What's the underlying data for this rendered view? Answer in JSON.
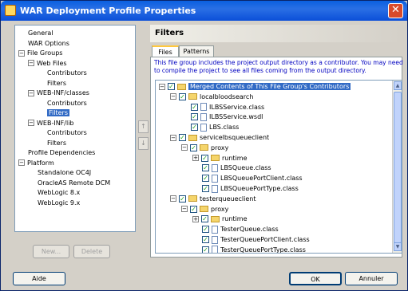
{
  "window": {
    "title": "WAR Deployment Profile Properties",
    "close_label": "✕"
  },
  "nav": {
    "items": [
      {
        "label": "General",
        "toggle": ""
      },
      {
        "label": "WAR Options",
        "toggle": ""
      },
      {
        "label": "File Groups",
        "toggle": "−"
      },
      {
        "label": "Web Files",
        "toggle": "−"
      },
      {
        "label": "Contributors",
        "toggle": ""
      },
      {
        "label": "Filters",
        "toggle": ""
      },
      {
        "label": "WEB-INF/classes",
        "toggle": "−"
      },
      {
        "label": "Contributors",
        "toggle": ""
      },
      {
        "label": "Filters",
        "toggle": ""
      },
      {
        "label": "WEB-INF/lib",
        "toggle": "−"
      },
      {
        "label": "Contributors",
        "toggle": ""
      },
      {
        "label": "Filters",
        "toggle": ""
      },
      {
        "label": "Profile Dependencies",
        "toggle": ""
      },
      {
        "label": "Platform",
        "toggle": "−"
      },
      {
        "label": "Standalone OC4J",
        "toggle": ""
      },
      {
        "label": "OracleAS Remote DCM",
        "toggle": ""
      },
      {
        "label": "WebLogic 8.x",
        "toggle": ""
      },
      {
        "label": "WebLogic 9.x",
        "toggle": ""
      }
    ],
    "selected": "Filters",
    "new_button": "New...",
    "delete_button": "Delete",
    "move_up": "↑",
    "move_down": "↓"
  },
  "main": {
    "title": "Filters",
    "tabs": [
      {
        "label": "Files"
      },
      {
        "label": "Patterns"
      }
    ],
    "active_tab": "Files",
    "description": "This file group includes the project output directory as a contributor.  You may need to compile the project to see all files coming from the output directory.",
    "tree": [
      {
        "label": "Merged Contents of This File Group's Contributors",
        "type": "folder",
        "toggle": "−"
      },
      {
        "label": "localbloodsearch",
        "type": "folder",
        "toggle": "−"
      },
      {
        "label": "ILBSService.class",
        "type": "file",
        "toggle": ""
      },
      {
        "label": "ILBSService.wsdl",
        "type": "file",
        "toggle": ""
      },
      {
        "label": "LBS.class",
        "type": "file",
        "toggle": ""
      },
      {
        "label": "servicelbsqueueclient",
        "type": "folder",
        "toggle": "−"
      },
      {
        "label": "proxy",
        "type": "folder",
        "toggle": "−"
      },
      {
        "label": "runtime",
        "type": "folder",
        "toggle": "+"
      },
      {
        "label": "LBSQueue.class",
        "type": "file",
        "toggle": ""
      },
      {
        "label": "LBSQueuePortClient.class",
        "type": "file",
        "toggle": ""
      },
      {
        "label": "LBSQueuePortType.class",
        "type": "file",
        "toggle": ""
      },
      {
        "label": "testerqueueclient",
        "type": "folder",
        "toggle": "−"
      },
      {
        "label": "proxy",
        "type": "folder",
        "toggle": "−"
      },
      {
        "label": "runtime",
        "type": "folder",
        "toggle": "+"
      },
      {
        "label": "TesterQueue.class",
        "type": "file",
        "toggle": ""
      },
      {
        "label": "TesterQueuePortClient.class",
        "type": "file",
        "toggle": ""
      },
      {
        "label": "TesterQueuePortType.class",
        "type": "file",
        "toggle": ""
      }
    ],
    "checkmark": "✓"
  },
  "footer": {
    "help_button": "Aide",
    "ok_button": "OK",
    "cancel_button": "Annuler"
  }
}
